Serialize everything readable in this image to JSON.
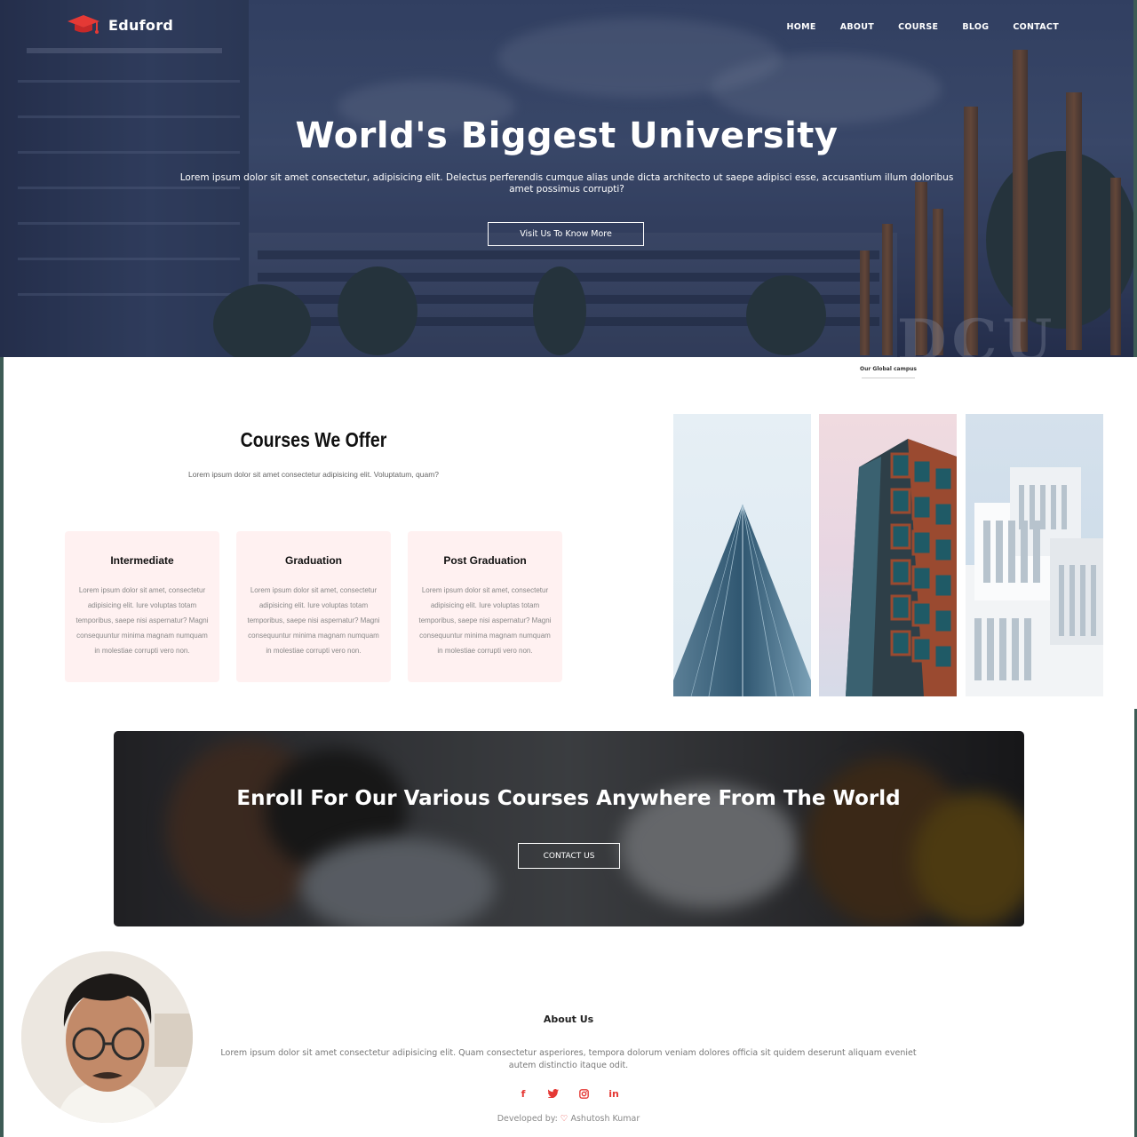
{
  "brand": {
    "name": "Eduford",
    "accent": "#e53935"
  },
  "nav": {
    "items": [
      "HOME",
      "ABOUT",
      "COURSE",
      "BLOG",
      "CONTACT"
    ]
  },
  "hero": {
    "title": "World's Biggest University",
    "subtitle": "Lorem ipsum dolor sit amet consectetur, adipisicing elit. Delectus perferendis cumque alias unde dicta architecto ut saepe adipisci esse, accusantium illum doloribus amet possimus corrupti?",
    "button": "Visit Us To Know More",
    "sign_text": "DCU"
  },
  "campus": {
    "caption": "Our Global campus"
  },
  "courses": {
    "title": "Courses We Offer",
    "subtitle": "Lorem ipsum dolor sit amet consectetur adipisicing elit. Voluptatum, quam?",
    "cards": [
      {
        "title": "Intermediate",
        "text": "Lorem ipsum dolor sit amet, consectetur adipisicing elit. Iure voluptas totam temporibus, saepe nisi aspernatur? Magni consequuntur minima magnam numquam in molestiae corrupti vero non."
      },
      {
        "title": "Graduation",
        "text": "Lorem ipsum dolor sit amet, consectetur adipisicing elit. Iure voluptas totam temporibus, saepe nisi aspernatur? Magni consequuntur minima magnam numquam in molestiae corrupti vero non."
      },
      {
        "title": "Post Graduation",
        "text": "Lorem ipsum dolor sit amet, consectetur adipisicing elit. Iure voluptas totam temporibus, saepe nisi aspernatur? Magni consequuntur minima magnam numquam in molestiae corrupti vero non."
      }
    ]
  },
  "enroll": {
    "title": "Enroll For Our Various Courses Anywhere From The World",
    "button": "CONTACT US"
  },
  "about": {
    "title": "About Us",
    "text": "Lorem ipsum dolor sit amet consectetur adipisicing elit. Quam consectetur asperiores, tempora dolorum veniam dolores officia sit quidem deserunt aliquam eveniet autem distinctio itaque odit.",
    "socials": [
      "facebook-icon",
      "twitter-icon",
      "instagram-icon",
      "linkedin-icon"
    ],
    "developer_prefix": "Developed by:",
    "developer_name": "Ashutosh Kumar"
  }
}
